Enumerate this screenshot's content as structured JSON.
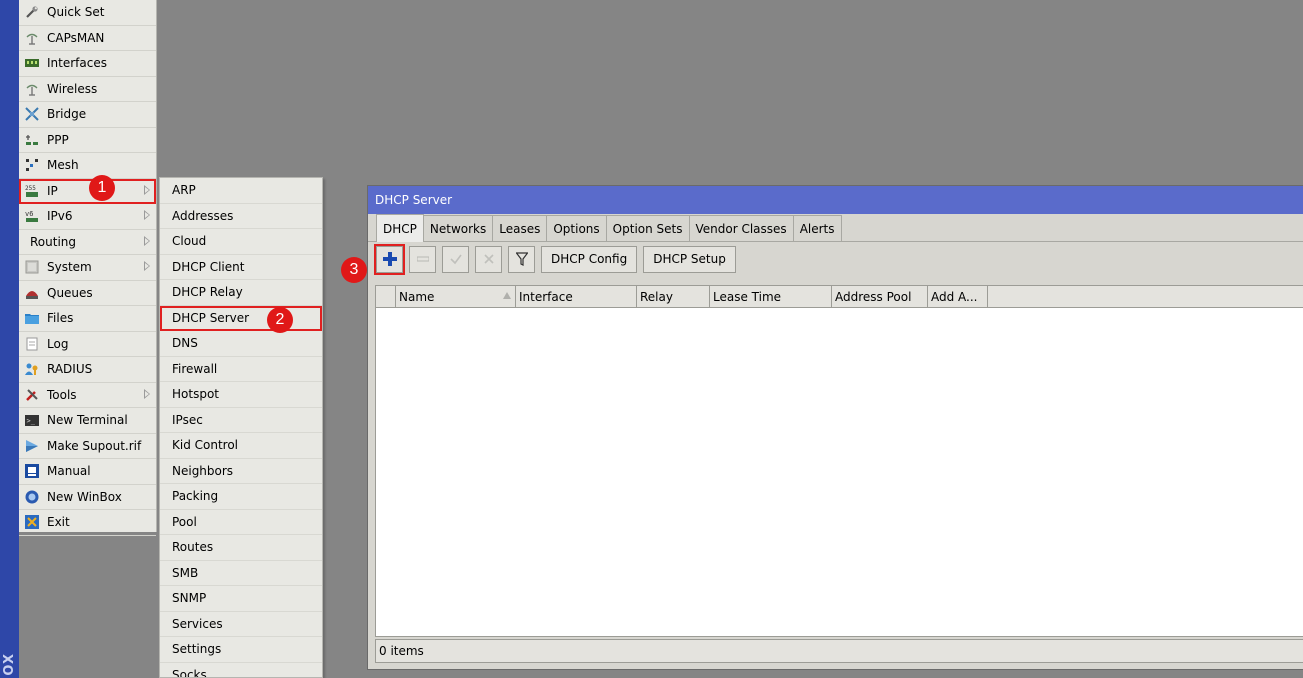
{
  "sidebar": {
    "vertical_text": "OX"
  },
  "main_menu": {
    "items": [
      {
        "label": "Quick Set",
        "icon": "wrench-icon"
      },
      {
        "label": "CAPsMAN",
        "icon": "antenna-icon"
      },
      {
        "label": "Interfaces",
        "icon": "interfaces-icon"
      },
      {
        "label": "Wireless",
        "icon": "wireless-icon"
      },
      {
        "label": "Bridge",
        "icon": "bridge-icon"
      },
      {
        "label": "PPP",
        "icon": "ppp-icon"
      },
      {
        "label": "Mesh",
        "icon": "mesh-icon"
      },
      {
        "label": "IP",
        "icon": "ip-icon"
      },
      {
        "label": "IPv6",
        "icon": "ipv6-icon"
      },
      {
        "label": "Routing",
        "icon": ""
      },
      {
        "label": "System",
        "icon": "system-icon"
      },
      {
        "label": "Queues",
        "icon": "queues-icon"
      },
      {
        "label": "Files",
        "icon": "folder-icon"
      },
      {
        "label": "Log",
        "icon": "log-icon"
      },
      {
        "label": "RADIUS",
        "icon": "radius-icon"
      },
      {
        "label": "Tools",
        "icon": "tools-icon"
      },
      {
        "label": "New Terminal",
        "icon": "terminal-icon"
      },
      {
        "label": "Make Supout.rif",
        "icon": "supout-icon"
      },
      {
        "label": "Manual",
        "icon": "manual-icon"
      },
      {
        "label": "New WinBox",
        "icon": "winbox-icon"
      },
      {
        "label": "Exit",
        "icon": "exit-icon"
      }
    ]
  },
  "ip_submenu": {
    "items": [
      "ARP",
      "Addresses",
      "Cloud",
      "DHCP Client",
      "DHCP Relay",
      "DHCP Server",
      "DNS",
      "Firewall",
      "Hotspot",
      "IPsec",
      "Kid Control",
      "Neighbors",
      "Packing",
      "Pool",
      "Routes",
      "SMB",
      "SNMP",
      "Services",
      "Settings",
      "Socks"
    ]
  },
  "annotations": {
    "step1": "1",
    "step2": "2",
    "step3": "3"
  },
  "window": {
    "title": "DHCP Server",
    "tabs": [
      "DHCP",
      "Networks",
      "Leases",
      "Options",
      "Option Sets",
      "Vendor Classes",
      "Alerts"
    ],
    "toolbar": {
      "dhcp_config": "DHCP Config",
      "dhcp_setup": "DHCP Setup"
    },
    "columns": [
      "Name",
      "Interface",
      "Relay",
      "Lease Time",
      "Address Pool",
      "Add A..."
    ],
    "status": "0 items"
  },
  "colors": {
    "accent_red": "#e01818",
    "titlebar": "#5a6bcb",
    "strip": "#2e47a8"
  }
}
